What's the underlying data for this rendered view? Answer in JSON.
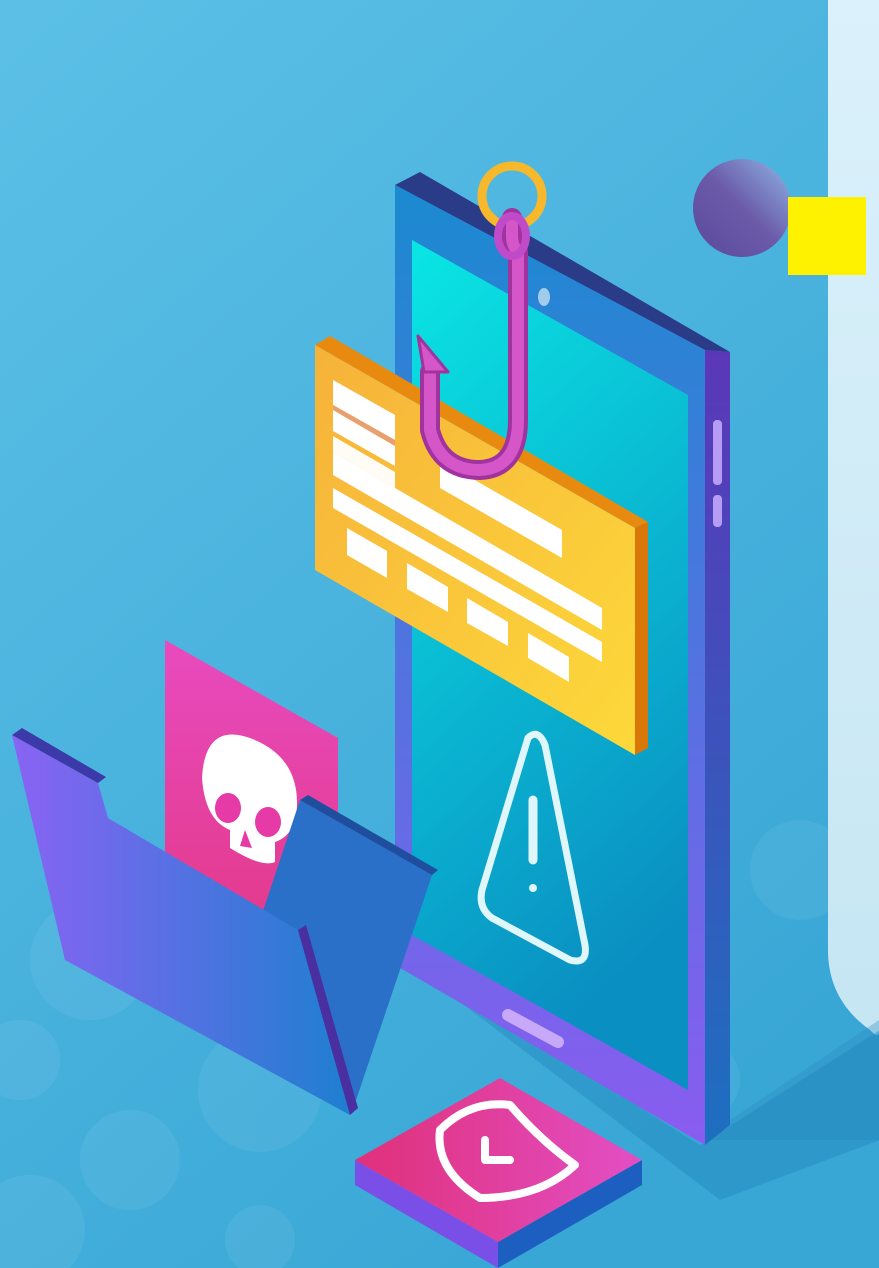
{
  "illustration": {
    "subject": "phishing",
    "elements": [
      "fishing-hook",
      "email-card",
      "smartphone",
      "warning-triangle",
      "folder",
      "skull-document",
      "shield-tile"
    ],
    "colors": {
      "background": "#3fb0dc",
      "background_light": "#6fcbee",
      "panel": "#d3edf8",
      "phone_frame": "#1d78c4",
      "phone_side": "#4b2fa6",
      "phone_screen_top": "#0ae2e2",
      "phone_screen_bottom": "#0a95c4",
      "email_card": "#f9c53a",
      "email_card_edge": "#e98a10",
      "hook": "#c04bc8",
      "line": "#f6a623",
      "folder": "#6b5ef2",
      "skull_doc": "#e63aa6",
      "shield_tile": "#e8379e",
      "yellow_square": "#fff200",
      "purple_circle": "#6b5aa8"
    }
  }
}
